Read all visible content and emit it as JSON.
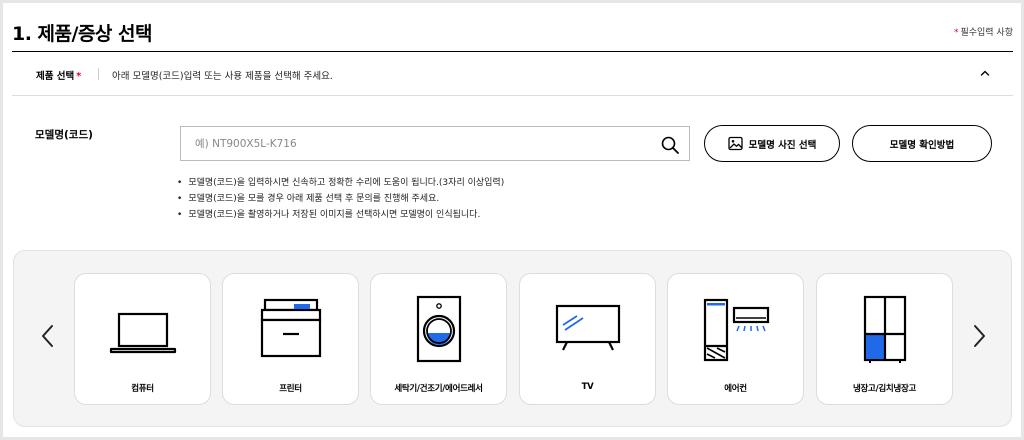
{
  "header": {
    "title": "1. 제품/증상 선택",
    "required_star": "*",
    "required_note": "필수입력 사항"
  },
  "section": {
    "label": "제품 선택",
    "required_star": "*",
    "description": "아래 모델명(코드)입력 또는 사용 제품을 선택해 주세요.",
    "collapse_icon": "chevron-up-icon"
  },
  "model": {
    "label": "모델명(코드)",
    "placeholder": "예) NT900X5L-K716",
    "value": "",
    "search_icon": "search-icon",
    "photo_button_label": "모델명 사진 선택",
    "guide_button_label": "모델명 확인방법",
    "notes": [
      "모델명(코드)을 입력하시면 신속하고 정확한 수리에 도움이 됩니다.(3자리 이상입력)",
      "모델명(코드)을 모를 경우 아래 제품 선택 후 문의를 진행해 주세요.",
      "모델명(코드)을 촬영하거나 저장된 이미지를 선택하시면 모델명이 인식됩니다."
    ]
  },
  "carousel": {
    "prev_icon": "chevron-left-icon",
    "next_icon": "chevron-right-icon",
    "items": [
      {
        "label": "컴퓨터",
        "icon": "laptop-icon"
      },
      {
        "label": "프린터",
        "icon": "printer-icon"
      },
      {
        "label": "세탁기/건조기/에어드레서",
        "icon": "washing-machine-icon"
      },
      {
        "label": "TV",
        "icon": "tv-icon"
      },
      {
        "label": "에어컨",
        "icon": "air-conditioner-icon"
      },
      {
        "label": "냉장고/김치냉장고",
        "icon": "refrigerator-icon"
      }
    ]
  },
  "colors": {
    "required": "#e4002b",
    "accent_blue": "#1e6ae8"
  }
}
